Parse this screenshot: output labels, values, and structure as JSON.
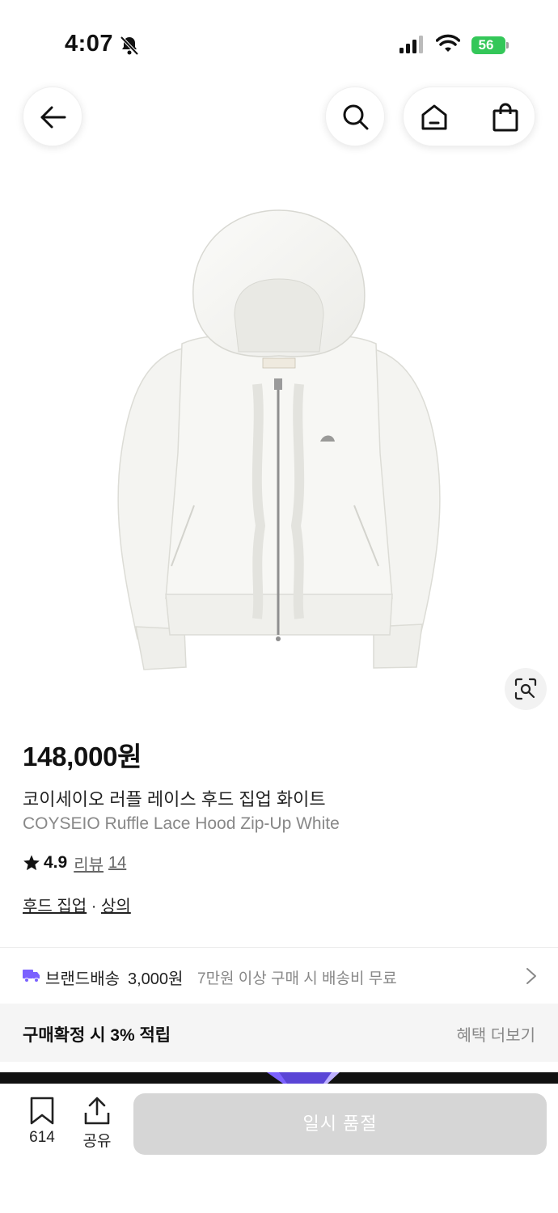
{
  "status_bar": {
    "time": "4:07",
    "battery": "56"
  },
  "product": {
    "price": "148,000원",
    "name_ko": "코이세이오 러플 레이스 후드 집업 화이트",
    "name_en": "COYSEIO Ruffle Lace Hood Zip-Up White",
    "rating": "4.9",
    "review_label": "리뷰",
    "review_count": "14",
    "category_primary": "후드 집업",
    "category_separator": "·",
    "category_secondary": "상의",
    "brand_label": "COYSEIO"
  },
  "shipping": {
    "label": "브랜드배송",
    "fee": "3,000원",
    "condition": "7만원 이상 구매 시 배송비 무료"
  },
  "benefit": {
    "text": "구매확정 시 3% 적립",
    "more": "혜택 더보기"
  },
  "bottom_bar": {
    "wish_count": "614",
    "share_label": "공유",
    "buy_label": "일시 품절"
  },
  "icons": [
    "back-arrow-icon",
    "search-icon",
    "home-icon",
    "shopping-bag-icon",
    "lens-search-icon",
    "star-icon",
    "truck-icon",
    "chevron-right-icon",
    "bookmark-icon",
    "share-icon"
  ],
  "colors": {
    "accent_purple": "#7b61ff",
    "battery_green": "#34c759",
    "soldout_gray": "#d6d6d6"
  }
}
